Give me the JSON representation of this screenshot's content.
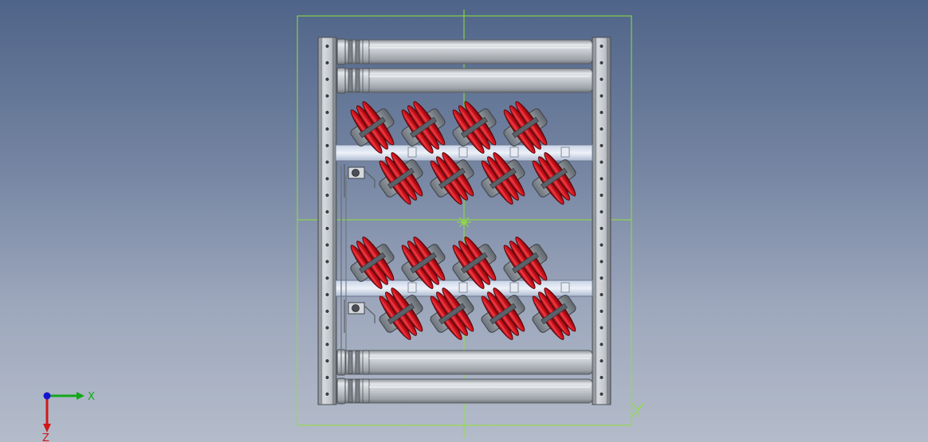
{
  "viewport": {
    "background_top": "#4f6489",
    "background_bottom": "#b4bcca",
    "selection_color": "#8fe03a",
    "roller_color": "#c5c9cf",
    "frame_color": "#b8bcc2",
    "wheel_color": "#d0111b",
    "wheel_dark": "#8c0a10",
    "hub_color": "#9aa0a8"
  },
  "triad": {
    "x_label": "X",
    "y_label": "Y",
    "z_label": "Z",
    "x_color": "#12a81a",
    "z_color": "#d01818",
    "origin_color": "#1414d0"
  },
  "model": {
    "icons": [
      "conveyor-model-icon",
      "origin-marker-icon",
      "coordinate-triad-icon"
    ],
    "top_roller_count": 2,
    "bottom_roller_count": 2,
    "wheel_bank_count": 2,
    "wheels_per_row": 4
  }
}
